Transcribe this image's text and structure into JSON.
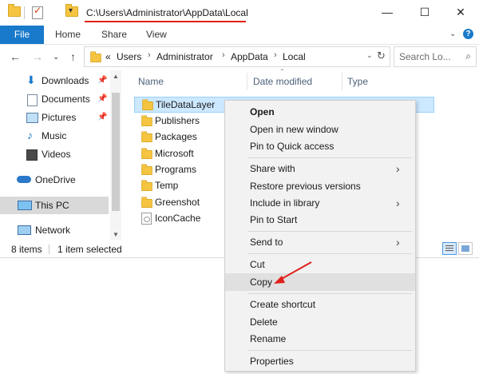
{
  "window": {
    "path_title": "C:\\Users\\Administrator\\AppData\\Local",
    "minimize": "—",
    "maximize": "☐",
    "close": "✕"
  },
  "ribbon": {
    "tabs": [
      "File",
      "Home",
      "Share",
      "View"
    ],
    "expand": "⌄",
    "help": "?"
  },
  "nav": {
    "back": "←",
    "forward": "→",
    "recent": "⌄",
    "up": "↑",
    "refresh": "↻"
  },
  "address": {
    "overflow": "«",
    "crumbs": [
      "Users",
      "Administrator",
      "AppData",
      "Local"
    ],
    "separator": "›"
  },
  "search": {
    "placeholder": "Search Lo...",
    "icon": "search-icon"
  },
  "navpane": {
    "items": [
      {
        "label": "Downloads",
        "icon": "download-icon",
        "pinned": true
      },
      {
        "label": "Documents",
        "icon": "documents-icon",
        "pinned": true
      },
      {
        "label": "Pictures",
        "icon": "pictures-icon",
        "pinned": true
      },
      {
        "label": "Music",
        "icon": "music-icon",
        "pinned": false
      },
      {
        "label": "Videos",
        "icon": "videos-icon",
        "pinned": false
      },
      {
        "label": "OneDrive",
        "icon": "onedrive-icon",
        "pinned": false
      },
      {
        "label": "This PC",
        "icon": "this-pc-icon",
        "pinned": false,
        "selected": true
      },
      {
        "label": "Network",
        "icon": "network-icon",
        "pinned": false
      }
    ]
  },
  "columns": [
    "Name",
    "Date modified",
    "Type"
  ],
  "files": [
    {
      "name": "TileDataLayer",
      "icon": "folder-icon",
      "selected": true
    },
    {
      "name": "Publishers",
      "icon": "folder-icon"
    },
    {
      "name": "Packages",
      "icon": "folder-icon"
    },
    {
      "name": "Microsoft",
      "icon": "folder-icon"
    },
    {
      "name": "Programs",
      "icon": "folder-icon"
    },
    {
      "name": "Temp",
      "icon": "folder-icon"
    },
    {
      "name": "Greenshot",
      "icon": "folder-icon"
    },
    {
      "name": "IconCache",
      "icon": "file-icon"
    }
  ],
  "status": {
    "count": "8 items",
    "selection": "1 item selected"
  },
  "context_menu": {
    "items": [
      {
        "label": "Open",
        "bold": true
      },
      {
        "label": "Open in new window"
      },
      {
        "label": "Pin to Quick access"
      },
      {
        "label": "Share with",
        "submenu": true
      },
      {
        "label": "Restore previous versions"
      },
      {
        "label": "Include in library",
        "submenu": true
      },
      {
        "label": "Pin to Start"
      },
      {
        "label": "Send to",
        "submenu": true
      },
      {
        "label": "Cut"
      },
      {
        "label": "Copy",
        "highlighted": true
      },
      {
        "label": "Create shortcut"
      },
      {
        "label": "Delete"
      },
      {
        "label": "Rename"
      },
      {
        "label": "Properties"
      }
    ],
    "submenu_arrow": "›"
  },
  "colors": {
    "accent": "#1979ca",
    "selection": "#cce8ff",
    "annotation": "#e0201a"
  }
}
